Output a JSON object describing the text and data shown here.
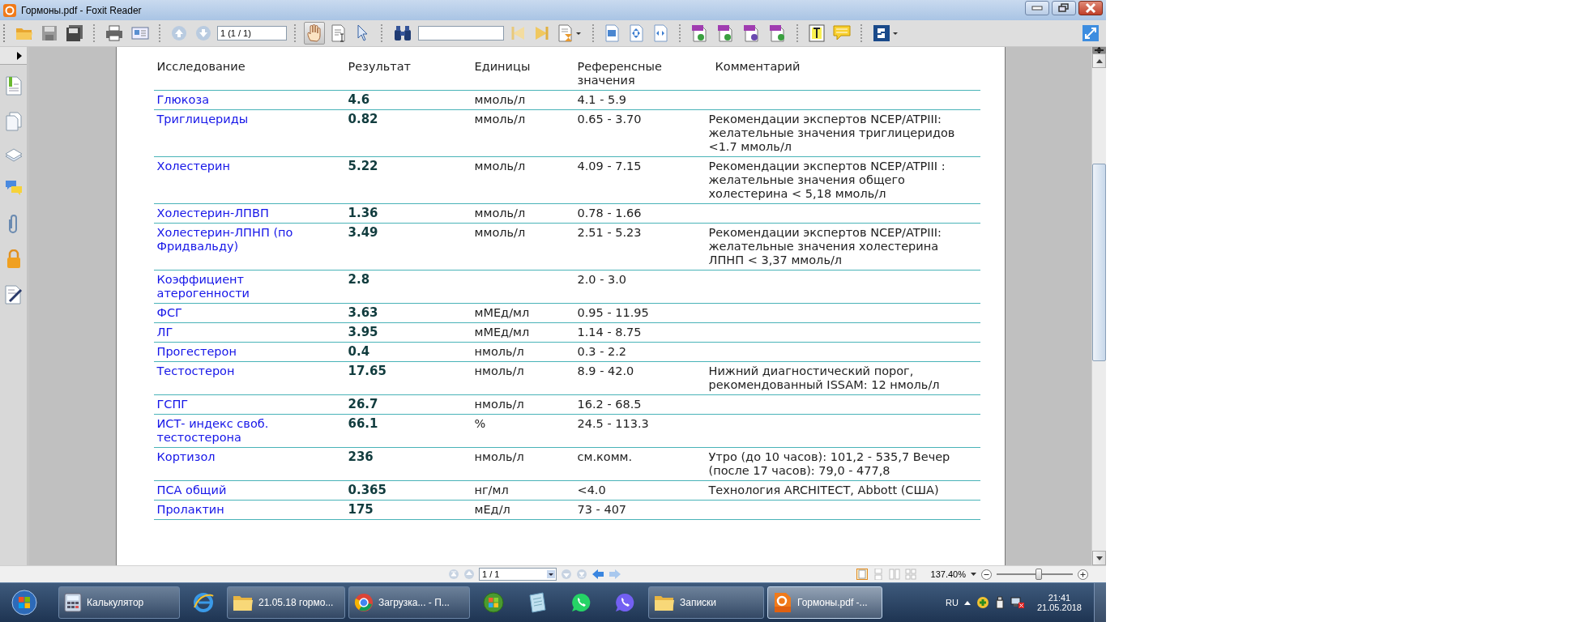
{
  "window": {
    "title": "Гормоны.pdf - Foxit Reader"
  },
  "toolbar": {
    "page_field": "1 (1 / 1)",
    "hand_tool_selected": true
  },
  "table": {
    "columns": [
      "Исследование",
      "Результат",
      "Единицы",
      "Референсные значения",
      "Комментарий"
    ],
    "rows": [
      {
        "test": "Глюкоза",
        "result": "4.6",
        "units": "ммоль/л",
        "reference": "4.1 - 5.9"
      },
      {
        "test": "Триглицериды",
        "result": "0.82",
        "units": "ммоль/л",
        "reference": "0.65 - 3.70",
        "comment": "Рекомендации экспертов NCEP/ATPIII: желательные значения триглицеридов <1.7 ммоль/л"
      },
      {
        "test": "Холестерин",
        "result": "5.22",
        "units": "ммоль/л",
        "reference": "4.09 - 7.15",
        "comment": "Рекомендации экспертов NCEP/ATPIII : желательные значения общего холестерина < 5,18 ммоль/л"
      },
      {
        "test": "Холестерин-ЛПВП",
        "result": "1.36",
        "units": "ммоль/л",
        "reference": "0.78 - 1.66"
      },
      {
        "test": "Холестерин-ЛПНП (по Фридвальду)",
        "result": "3.49",
        "units": "ммоль/л",
        "reference": "2.51 - 5.23",
        "comment": "Рекомендации экспертов NCEP/ATPIII: желательные значения холестерина ЛПНП < 3,37 ммоль/л"
      },
      {
        "test": "Коэффициент атерогенности",
        "result": "2.8",
        "reference": "2.0 - 3.0"
      },
      {
        "test": "ФСГ",
        "result": "3.63",
        "units": "мМЕд/мл",
        "reference": "0.95 - 11.95"
      },
      {
        "test": "ЛГ",
        "result": "3.95",
        "units": "мМЕд/мл",
        "reference": "1.14 - 8.75"
      },
      {
        "test": "Прогестерон",
        "result": "0.4",
        "units": "нмоль/л",
        "reference": "0.3 - 2.2"
      },
      {
        "test": "Тестостерон",
        "result": "17.65",
        "units": "нмоль/л",
        "reference": "8.9 - 42.0",
        "comment": "Нижний диагностический порог, рекомендованный ISSAM: 12 нмоль/л"
      },
      {
        "test": "ГСПГ",
        "result": "26.7",
        "units": "нмоль/л",
        "reference": "16.2 - 68.5"
      },
      {
        "test": "ИСТ- индекс своб. тестостерона",
        "result": "66.1",
        "units": "%",
        "reference": "24.5 - 113.3"
      },
      {
        "test": "Кортизол",
        "result": "236",
        "units": "нмоль/л",
        "reference": "см.комм.",
        "comment": "Утро (до 10 часов): 101,2 - 535,7 Вечер (после 17 часов): 79,0 - 477,8"
      },
      {
        "test": "ПСА общий",
        "result": "0.365",
        "units": "нг/мл",
        "reference": "<4.0",
        "comment": "Технология ARCHITECT, Abbott (США)"
      },
      {
        "test": "Пролактин",
        "result": "175",
        "units": "мЕд/л",
        "reference": "73 - 407"
      }
    ]
  },
  "status_bar": {
    "page_field": "1 / 1",
    "zoom": "137.40%",
    "zoom_slider": {
      "level": 0.55
    }
  },
  "taskbar": {
    "items": [
      {
        "label": "Калькулятор",
        "selected": false
      },
      {
        "selected": false
      },
      {
        "label": "21.05.18 гормо...",
        "selected": false
      },
      {
        "label": "Загрузка... - П...",
        "selected": false
      },
      {
        "selected": false
      },
      {
        "selected": false
      },
      {
        "selected": false
      },
      {
        "selected": false
      },
      {
        "label": "Записки",
        "selected": false
      },
      {
        "label": "Гормоны.pdf -...",
        "selected": true
      }
    ],
    "tray": {
      "language": "RU",
      "time": "21:41",
      "date": "21.05.2018"
    }
  }
}
